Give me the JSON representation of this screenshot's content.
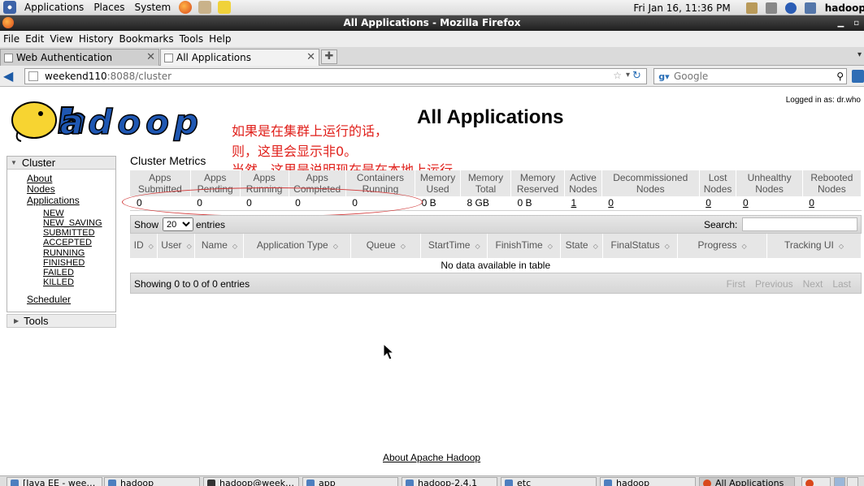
{
  "panel": {
    "menus": [
      "Applications",
      "Places",
      "System"
    ],
    "clock": "Fri Jan 16, 11:36 PM",
    "user": "hadoop"
  },
  "window": {
    "title": "All Applications - Mozilla Firefox"
  },
  "menubar": [
    "File",
    "Edit",
    "View",
    "History",
    "Bookmarks",
    "Tools",
    "Help"
  ],
  "tabs": [
    {
      "label": "Web Authentication",
      "active": false
    },
    {
      "label": "All Applications",
      "active": true
    }
  ],
  "navbar": {
    "url_host": "weekend110",
    "url_rest": ":8088/cluster",
    "search_placeholder": "Google"
  },
  "page": {
    "title": "All Applications",
    "logged_in": "Logged in as: dr.who",
    "annotation_lines": [
      "如果是在集群上运行的话，",
      "则，这里会显示非0。",
      "当然，这里是说明现在是在本地上运行"
    ],
    "sidebar": {
      "cluster": "Cluster",
      "links": [
        "About",
        "Nodes",
        "Applications"
      ],
      "app_states": [
        "NEW",
        "NEW_SAVING",
        "SUBMITTED",
        "ACCEPTED",
        "RUNNING",
        "FINISHED",
        "FAILED",
        "KILLED"
      ],
      "scheduler": "Scheduler",
      "tools": "Tools"
    },
    "metrics": {
      "title": "Cluster Metrics",
      "headers": [
        [
          "Apps",
          "Submitted"
        ],
        [
          "Apps",
          "Pending"
        ],
        [
          "Apps",
          "Running"
        ],
        [
          "Apps",
          "Completed"
        ],
        [
          "Containers",
          "Running"
        ],
        [
          "Memory",
          "Used"
        ],
        [
          "Memory",
          "Total"
        ],
        [
          "Memory",
          "Reserved"
        ],
        [
          "Active",
          "Nodes"
        ],
        [
          "Decommissioned",
          "Nodes"
        ],
        [
          "Lost",
          "Nodes"
        ],
        [
          "Unhealthy",
          "Nodes"
        ],
        [
          "Rebooted",
          "Nodes"
        ]
      ],
      "values": [
        "0",
        "0",
        "0",
        "0",
        "0",
        "0 B",
        "8 GB",
        "0 B",
        "1",
        "0",
        "0",
        "0",
        "0"
      ]
    },
    "apps": {
      "show": "Show",
      "entries_value": "20",
      "entries": "entries",
      "search": "Search:",
      "headers": [
        [
          "ID",
          ""
        ],
        [
          "User",
          ""
        ],
        [
          "Name",
          ""
        ],
        [
          "Application Type",
          ""
        ],
        [
          "Queue",
          ""
        ],
        [
          "StartTime",
          ""
        ],
        [
          "FinishTime",
          ""
        ],
        [
          "State",
          ""
        ],
        [
          "FinalStatus",
          ""
        ],
        [
          "Progress",
          ""
        ],
        [
          "Tracking UI",
          ""
        ]
      ],
      "empty": "No data available in table",
      "info": "Showing 0 to 0 of 0 entries",
      "pager": [
        "First",
        "Previous",
        "Next",
        "Last"
      ]
    },
    "footer": "About Apache Hadoop"
  },
  "taskbar": [
    "[Java EE - wee…",
    "hadoop",
    "hadoop@week…",
    "app",
    "hadoop-2.4.1",
    "etc",
    "hadoop",
    "All Applications"
  ]
}
